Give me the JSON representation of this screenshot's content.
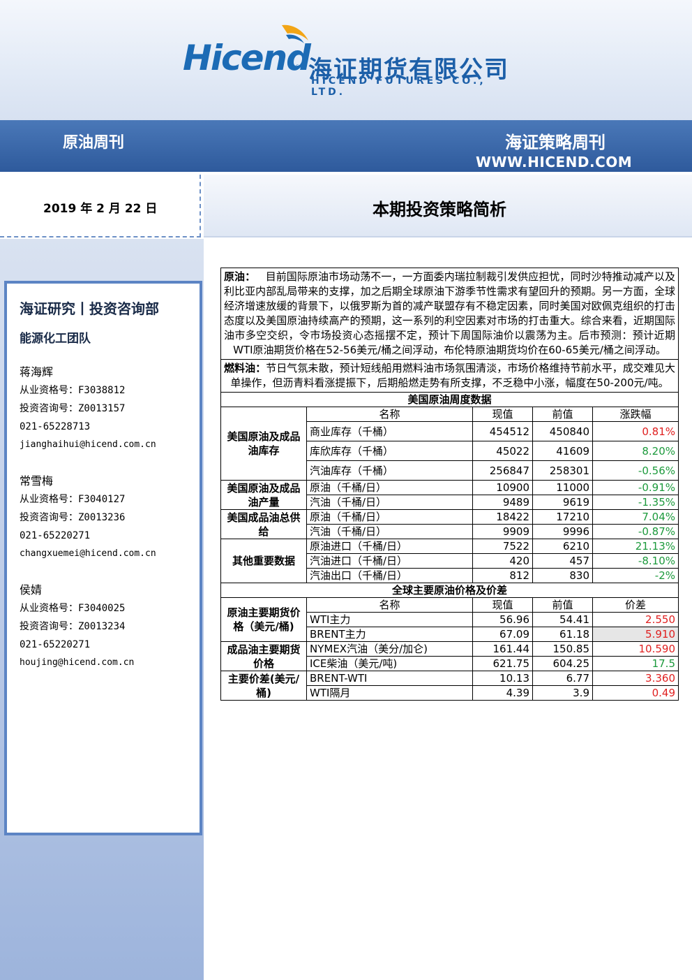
{
  "header": {
    "logo_en": "Hicend",
    "logo_cn": "海证期货有限公司",
    "logo_en_full": "HICEND  FUTURES  CO.,  LTD.",
    "title_left": "原油周刊",
    "title_right": "海证策略周刊",
    "url": "WWW.HICEND.COM"
  },
  "date": "2019 年 2 月 22 日",
  "subtitle": "本期投资策略简析",
  "sidebar": {
    "title": "海证研究丨投资咨询部",
    "team": "能源化工团队",
    "contacts": [
      {
        "name": "蒋海辉",
        "qual": "从业资格号：F3038812",
        "consult": "投资咨询号：Z0013157",
        "phone": "021-65228713",
        "email": "jianghaihui@hicend.com.cn"
      },
      {
        "name": "常雪梅",
        "qual": "从业资格号：F3040127",
        "consult": "投资咨询号：Z0013236",
        "phone": "021-65220271",
        "email": "changxuemei@hicend.com.cn"
      },
      {
        "name": "侯婧",
        "qual": "从业资格号：F3040025",
        "consult": "投资咨询号：Z0013234",
        "phone": "021-65220271",
        "email": "houjing@hicend.com.cn"
      }
    ]
  },
  "report": {
    "crude_label": "原油：",
    "crude_text": "目前国际原油市场动荡不一，一方面委内瑞拉制裁引发供应担忧，同时沙特推动减产以及利比亚内部乱局带来的支撑，加之后期全球原油下游季节性需求有望回升的预期。另一方面，全球经济增速放缓的背景下，以俄罗斯为首的减产联盟存有不稳定因素，同时美国对欧佩克组织的打击态度以及美国原油持续高产的预期，这一系列的利空因素对市场的打击重大。综合来看，近期国际油市多空交织，令市场投资心态摇摆不定，预计下周国际油价以震荡为主。后市预测：预计近期WTI原油期货价格在52-56美元/桶之间浮动，布伦特原油期货均价在60-65美元/桶之间浮动。",
    "fuel_label": "燃料油：",
    "fuel_text": "节日气氛未散，预计短线船用燃料油市场氛围清淡，市场价格维持节前水平，成交难见大单操作，但沥青料看涨提振下，后期船燃走势有所支撑，不乏稳中小涨，幅度在50-200元/吨。",
    "weekly_title": "美国原油周度数据",
    "weekly_headers": [
      "名称",
      "现值",
      "前值",
      "涨跌幅"
    ],
    "weekly_groups": [
      {
        "label": "美国原油及成品油库存",
        "rows": [
          {
            "name": "商业库存（千桶）",
            "cur": "454512",
            "prev": "450840",
            "chg": "0.81%",
            "dir": "up"
          },
          {
            "name": "库欣库存（千桶）",
            "cur": "45022",
            "prev": "41609",
            "chg": "8.20%",
            "dir": "down"
          },
          {
            "name": "汽油库存（千桶）",
            "cur": "256847",
            "prev": "258301",
            "chg": "-0.56%",
            "dir": "down"
          }
        ]
      },
      {
        "label": "美国原油及成品油产量",
        "rows": [
          {
            "name": "原油（千桶/日）",
            "cur": "10900",
            "prev": "11000",
            "chg": "-0.91%",
            "dir": "down"
          },
          {
            "name": "汽油（千桶/日）",
            "cur": "9489",
            "prev": "9619",
            "chg": "-1.35%",
            "dir": "down"
          }
        ]
      },
      {
        "label": "美国成品油总供给",
        "rows": [
          {
            "name": "原油（千桶/日）",
            "cur": "18422",
            "prev": "17210",
            "chg": "7.04%",
            "dir": "down"
          },
          {
            "name": "汽油（千桶/日）",
            "cur": "9909",
            "prev": "9996",
            "chg": "-0.87%",
            "dir": "down"
          }
        ]
      },
      {
        "label": "其他重要数据",
        "rows": [
          {
            "name": "原油进口（千桶/日）",
            "cur": "7522",
            "prev": "6210",
            "chg": "21.13%",
            "dir": "down"
          },
          {
            "name": "汽油进口（千桶/日）",
            "cur": "420",
            "prev": "457",
            "chg": "-8.10%",
            "dir": "down"
          },
          {
            "name": "汽油出口（千桶/日）",
            "cur": "812",
            "prev": "830",
            "chg": "-2%",
            "dir": "down"
          }
        ]
      }
    ],
    "price_title": "全球主要原油价格及价差",
    "price_headers": [
      "名称",
      "现值",
      "前值",
      "价差"
    ],
    "price_groups": [
      {
        "label": "原油主要期货价格（美元/桶)",
        "rows": [
          {
            "name": "WTI主力",
            "cur": "56.96",
            "prev": "54.41",
            "chg": "2.550",
            "dir": "up"
          },
          {
            "name": "BRENT主力",
            "cur": "67.09",
            "prev": "61.18",
            "chg": "5.910",
            "dir": "up"
          }
        ]
      },
      {
        "label": "成品油主要期货价格",
        "rows": [
          {
            "name": "NYMEX汽油（美分/加仑)",
            "cur": "161.44",
            "prev": "150.85",
            "chg": "10.590",
            "dir": "up"
          },
          {
            "name": "ICE柴油（美元/吨)",
            "cur": "621.75",
            "prev": "604.25",
            "chg": "17.5",
            "dir": "down"
          }
        ]
      },
      {
        "label": "主要价差(美元/桶)",
        "rows": [
          {
            "name": "BRENT-WTI",
            "cur": "10.13",
            "prev": "6.77",
            "chg": "3.360",
            "dir": "up"
          },
          {
            "name": "WTI隔月",
            "cur": "4.39",
            "prev": "3.9",
            "chg": "0.49",
            "dir": "up"
          }
        ]
      }
    ]
  }
}
